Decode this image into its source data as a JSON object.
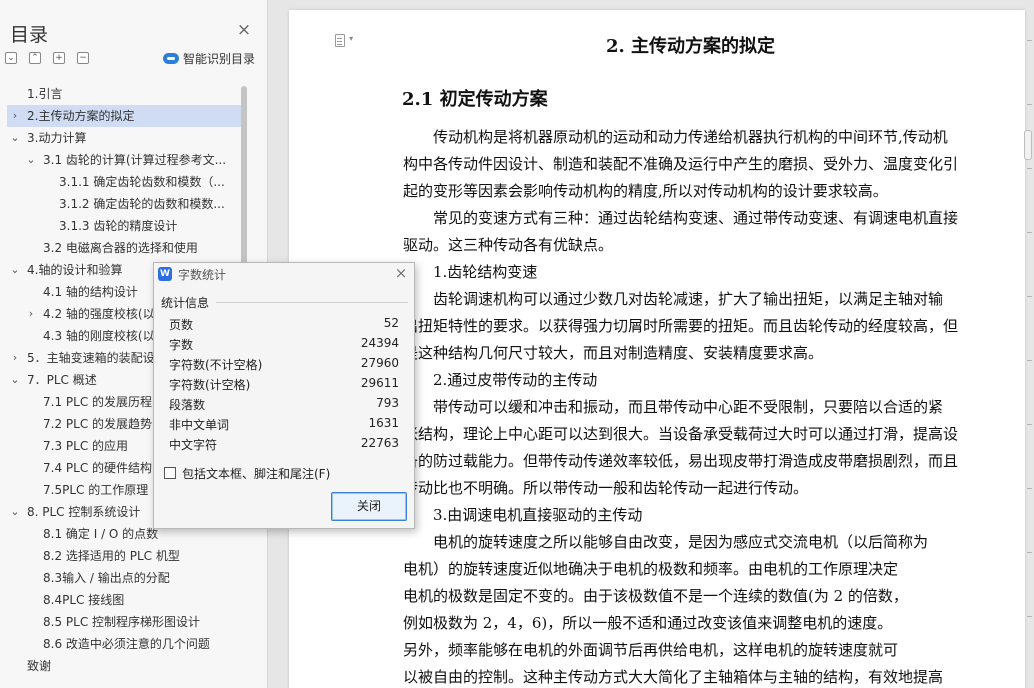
{
  "outline": {
    "title": "目录",
    "smart_toc_label": "智能识别目录",
    "items": [
      {
        "label": "1.引言",
        "level": 0,
        "caret": "",
        "selected": false
      },
      {
        "label": "2.主传动方案的拟定",
        "level": 0,
        "caret": ">",
        "selected": true
      },
      {
        "label": "3.动力计算",
        "level": 0,
        "caret": "v",
        "selected": false
      },
      {
        "label": "3.1  齿轮的计算(计算过程参考文...",
        "level": 1,
        "caret": "v",
        "selected": false
      },
      {
        "label": "3.1.1  确定齿轮齿数和模数（...",
        "level": 2,
        "caret": "",
        "selected": false
      },
      {
        "label": "3.1.2  确定齿轮的齿数和模数...",
        "level": 2,
        "caret": "",
        "selected": false
      },
      {
        "label": "3.1.3  齿轮的精度设计",
        "level": 2,
        "caret": "",
        "selected": false
      },
      {
        "label": "3.2  电磁离合器的选择和使用",
        "level": 1,
        "caret": "",
        "selected": false
      },
      {
        "label": "4.轴的设计和验算",
        "level": 0,
        "caret": "v",
        "selected": false
      },
      {
        "label": "4.1  轴的结构设计",
        "level": 1,
        "caret": "",
        "selected": false
      },
      {
        "label": "4.2  轴的强度校核(以",
        "level": 1,
        "caret": ">",
        "selected": false
      },
      {
        "label": "4.3  轴的刚度校核(以",
        "level": 1,
        "caret": "",
        "selected": false
      },
      {
        "label": "5．主轴变速箱的装配设",
        "level": 0,
        "caret": ">",
        "selected": false
      },
      {
        "label": "7．PLC 概述",
        "level": 0,
        "caret": "v",
        "selected": false
      },
      {
        "label": "7.1 PLC 的发展历程",
        "level": 1,
        "caret": "",
        "selected": false
      },
      {
        "label": "7.2    PLC 的发展趋势",
        "level": 1,
        "caret": "",
        "selected": false
      },
      {
        "label": "7.3    PLC 的应用",
        "level": 1,
        "caret": "",
        "selected": false
      },
      {
        "label": "7.4 PLC 的硬件结构",
        "level": 1,
        "caret": "",
        "selected": false
      },
      {
        "label": "7.5PLC 的工作原理",
        "level": 1,
        "caret": "",
        "selected": false
      },
      {
        "label": "8. PLC 控制系统设计",
        "level": 0,
        "caret": "v",
        "selected": false
      },
      {
        "label": "8.1  确定 I / O 的点数",
        "level": 1,
        "caret": "",
        "selected": false
      },
      {
        "label": "8.2    选择适用的 PLC 机型",
        "level": 1,
        "caret": "",
        "selected": false
      },
      {
        "label": "8.3输入 / 输出点的分配",
        "level": 1,
        "caret": "",
        "selected": false
      },
      {
        "label": "8.4PLC 接线图",
        "level": 1,
        "caret": "",
        "selected": false
      },
      {
        "label": "8.5    PLC 控制程序梯形图设计",
        "level": 1,
        "caret": "",
        "selected": false
      },
      {
        "label": "8.6  改造中必须注意的几个问题",
        "level": 1,
        "caret": "",
        "selected": false
      },
      {
        "label": "致谢",
        "level": 0,
        "caret": "",
        "selected": false
      }
    ]
  },
  "document": {
    "heading": "2. 主传动方案的拟定",
    "subheading": "2.1  初定传动方案",
    "lines": [
      {
        "text": "传动机构是将机器原动机的运动和动力传递给机器执行机构的中间环节,传动机",
        "indent": 1
      },
      {
        "text": "构中各传动件因设计、制造和装配不准确及运行中产生的磨损、受外力、温度变化引",
        "indent": 0
      },
      {
        "text": "起的变形等因素会影响传动机构的精度,所以对传动机构的设计要求较高。",
        "indent": 0
      },
      {
        "text": "常见的变速方式有三种：通过齿轮结构变速、通过带传动变速、有调速电机直接",
        "indent": 1
      },
      {
        "text": "驱动。这三种传动各有优缺点。",
        "indent": 0
      },
      {
        "text": "1.齿轮结构变速",
        "indent": 1
      },
      {
        "text": "齿轮调速机构可以通过少数几对齿轮减速，扩大了输出扭矩，以满足主轴对输",
        "indent": 1
      },
      {
        "text": "出扭矩特性的要求。以获得强力切屑时所需要的扭矩。而且齿轮传动的经度较高，但",
        "indent": 0
      },
      {
        "text": "是这种结构几何尺寸较大，而且对制造精度、安装精度要求高。",
        "indent": 0
      },
      {
        "text": "2.通过皮带传动的主传动",
        "indent": 1
      },
      {
        "text": "带传动可以缓和冲击和振动，而且带传动中心距不受限制，只要陪以合适的紧",
        "indent": 1
      },
      {
        "text": "张结构，理论上中心距可以达到很大。当设备承受载荷过大时可以通过打滑，提高设",
        "indent": 0
      },
      {
        "text": "备的防过载能力。但带传动传递效率较低，易出现皮带打滑造成皮带磨损剧烈，而且",
        "indent": 0
      },
      {
        "text": "传动比也不明确。所以带传动一般和齿轮传动一起进行传动。",
        "indent": 0
      },
      {
        "text": "3.由调速电机直接驱动的主传动",
        "indent": 1
      },
      {
        "text": "电机的旋转速度之所以能够自由改变，是因为感应式交流电机（以后简称为",
        "indent": 1
      },
      {
        "text": "电机）的旋转速度近似地确决于电机的极数和频率。由电机的工作原理决定",
        "indent": 0
      },
      {
        "text": "电机的极数是固定不变的。由于该极数值不是一个连续的数值(为 2 的倍数，",
        "indent": 0
      },
      {
        "text": "例如极数为 2，4，6)，所以一般不适和通过改变该值来调整电机的速度。",
        "indent": 0
      },
      {
        "text": "另外，频率能够在电机的外面调节后再供给电机，这样电机的旋转速度就可",
        "indent": 0
      },
      {
        "text": "以被自由的控制。这种主传动方式大大简化了主轴箱体与主轴的结构，有效地提高",
        "indent": 0
      }
    ]
  },
  "dialog": {
    "title": "字数统计",
    "app_icon_letter": "W",
    "group_label": "统计信息",
    "stats": [
      {
        "label": "页数",
        "value": "52"
      },
      {
        "label": "字数",
        "value": "24394"
      },
      {
        "label": "字符数(不计空格)",
        "value": "27960"
      },
      {
        "label": "字符数(计空格)",
        "value": "29611"
      },
      {
        "label": "段落数",
        "value": "793"
      },
      {
        "label": "非中文单词",
        "value": "1631"
      },
      {
        "label": "中文字符",
        "value": "22763"
      }
    ],
    "include_checkbox_label": "包括文本框、脚注和尾注(F)",
    "include_checked": false,
    "close_button_label": "关闭"
  }
}
